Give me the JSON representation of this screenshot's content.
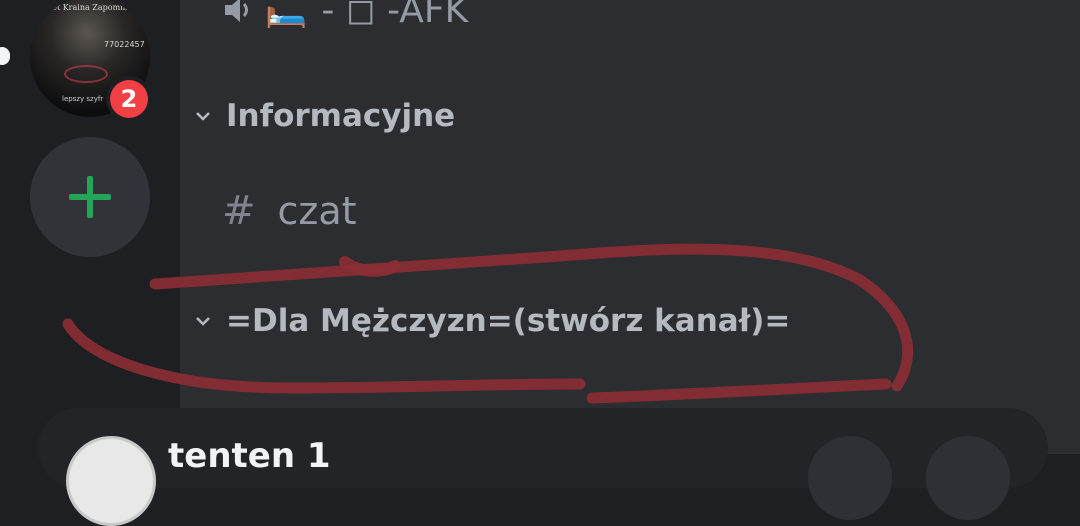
{
  "server_rail": {
    "server_icon": {
      "title_text": "zet Kraina Zapomnien.",
      "number_text": "77022457",
      "tag_text": "lepszy szyfr"
    },
    "mention_badge": "2",
    "add_server_icon": "plus-icon"
  },
  "channel_list": {
    "voice_channel": {
      "icon": "speaker-icon",
      "emoji": "🛏️",
      "label": "- ◻ -AFK"
    },
    "categories": [
      {
        "label": "Informacyjne",
        "icon": "chevron-down-icon"
      },
      {
        "label": "=Dla Mężczyzn=(stwórz kanał)=",
        "icon": "chevron-down-icon"
      }
    ],
    "text_channel": {
      "hash": "#",
      "label": "czat"
    }
  },
  "user_panel": {
    "name": "tenten 1"
  },
  "colors": {
    "rail_bg": "#1e1f22",
    "channels_bg": "#2b2d31",
    "badge_red": "#f23f43",
    "plus_green": "#23a55a",
    "scribble": "#8b2e34"
  }
}
